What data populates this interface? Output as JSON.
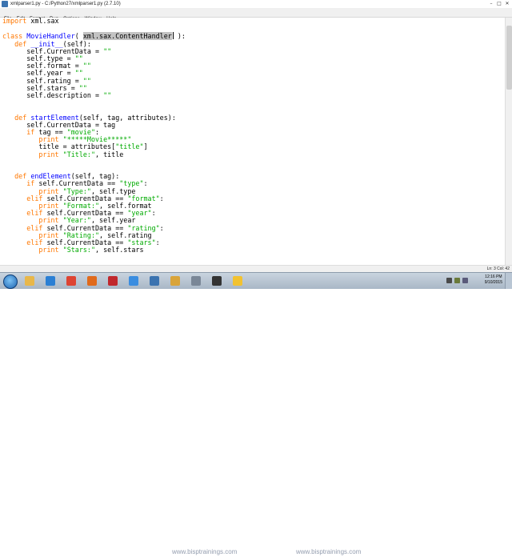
{
  "window": {
    "title": "xmlparser1.py - C:/Python27/xmlparser1.py (2.7.10)",
    "controls": [
      "–",
      "□",
      "✕"
    ]
  },
  "menu": [
    "File",
    "Edit",
    "Format",
    "Run",
    "Options",
    "Window",
    "Help"
  ],
  "code_lines": [
    [
      {
        "t": "import",
        "c": "kw"
      },
      {
        "t": " xml.sax"
      }
    ],
    [
      {
        "t": ""
      }
    ],
    [
      {
        "t": "class",
        "c": "kw"
      },
      {
        "t": " "
      },
      {
        "t": "MovieHandler",
        "c": "def"
      },
      {
        "t": "( "
      },
      {
        "t": "xml.sax.ContentHandler",
        "c": "sel"
      },
      {
        "t": "",
        "caret": true
      },
      {
        "t": " ):"
      }
    ],
    [
      {
        "t": "   "
      },
      {
        "t": "def",
        "c": "kw"
      },
      {
        "t": " "
      },
      {
        "t": "__init__",
        "c": "def"
      },
      {
        "t": "(self):"
      }
    ],
    [
      {
        "t": "      self.CurrentData = "
      },
      {
        "t": "\"\"",
        "c": "str"
      }
    ],
    [
      {
        "t": "      self.type = "
      },
      {
        "t": "\"\"",
        "c": "str"
      }
    ],
    [
      {
        "t": "      self.format = "
      },
      {
        "t": "\"\"",
        "c": "str"
      }
    ],
    [
      {
        "t": "      self.year = "
      },
      {
        "t": "\"\"",
        "c": "str"
      }
    ],
    [
      {
        "t": "      self.rating = "
      },
      {
        "t": "\"\"",
        "c": "str"
      }
    ],
    [
      {
        "t": "      self.stars = "
      },
      {
        "t": "\"\"",
        "c": "str"
      }
    ],
    [
      {
        "t": "      self.description = "
      },
      {
        "t": "\"\"",
        "c": "str"
      }
    ],
    [
      {
        "t": ""
      }
    ],
    [
      {
        "t": ""
      }
    ],
    [
      {
        "t": "   "
      },
      {
        "t": "def",
        "c": "kw"
      },
      {
        "t": " "
      },
      {
        "t": "startElement",
        "c": "def"
      },
      {
        "t": "(self, tag, attributes):"
      }
    ],
    [
      {
        "t": "      self.CurrentData = tag"
      }
    ],
    [
      {
        "t": "      "
      },
      {
        "t": "if",
        "c": "kw"
      },
      {
        "t": " tag == "
      },
      {
        "t": "\"movie\"",
        "c": "str"
      },
      {
        "t": ":"
      }
    ],
    [
      {
        "t": "         "
      },
      {
        "t": "print",
        "c": "kw"
      },
      {
        "t": " "
      },
      {
        "t": "\"*****Movie*****\"",
        "c": "str"
      }
    ],
    [
      {
        "t": "         title = attributes["
      },
      {
        "t": "\"title\"",
        "c": "str"
      },
      {
        "t": "]"
      }
    ],
    [
      {
        "t": "         "
      },
      {
        "t": "print",
        "c": "kw"
      },
      {
        "t": " "
      },
      {
        "t": "\"Title:\"",
        "c": "str"
      },
      {
        "t": ", title"
      }
    ],
    [
      {
        "t": ""
      }
    ],
    [
      {
        "t": ""
      }
    ],
    [
      {
        "t": "   "
      },
      {
        "t": "def",
        "c": "kw"
      },
      {
        "t": " "
      },
      {
        "t": "endElement",
        "c": "def"
      },
      {
        "t": "(self, tag):"
      }
    ],
    [
      {
        "t": "      "
      },
      {
        "t": "if",
        "c": "kw"
      },
      {
        "t": " self.CurrentData == "
      },
      {
        "t": "\"type\"",
        "c": "str"
      },
      {
        "t": ":"
      }
    ],
    [
      {
        "t": "         "
      },
      {
        "t": "print",
        "c": "kw"
      },
      {
        "t": " "
      },
      {
        "t": "\"Type:\"",
        "c": "str"
      },
      {
        "t": ", self.type"
      }
    ],
    [
      {
        "t": "      "
      },
      {
        "t": "elif",
        "c": "kw"
      },
      {
        "t": " self.CurrentData == "
      },
      {
        "t": "\"format\"",
        "c": "str"
      },
      {
        "t": ":"
      }
    ],
    [
      {
        "t": "         "
      },
      {
        "t": "print",
        "c": "kw"
      },
      {
        "t": " "
      },
      {
        "t": "\"Format:\"",
        "c": "str"
      },
      {
        "t": ", self.format"
      }
    ],
    [
      {
        "t": "      "
      },
      {
        "t": "elif",
        "c": "kw"
      },
      {
        "t": " self.CurrentData == "
      },
      {
        "t": "\"year\"",
        "c": "str"
      },
      {
        "t": ":"
      }
    ],
    [
      {
        "t": "         "
      },
      {
        "t": "print",
        "c": "kw"
      },
      {
        "t": " "
      },
      {
        "t": "\"Year:\"",
        "c": "str"
      },
      {
        "t": ", self.year"
      }
    ],
    [
      {
        "t": "      "
      },
      {
        "t": "elif",
        "c": "kw"
      },
      {
        "t": " self.CurrentData == "
      },
      {
        "t": "\"rating\"",
        "c": "str"
      },
      {
        "t": ":"
      }
    ],
    [
      {
        "t": "         "
      },
      {
        "t": "print",
        "c": "kw"
      },
      {
        "t": " "
      },
      {
        "t": "\"Rating:\"",
        "c": "str"
      },
      {
        "t": ", self.rating"
      }
    ],
    [
      {
        "t": "      "
      },
      {
        "t": "elif",
        "c": "kw"
      },
      {
        "t": " self.CurrentData == "
      },
      {
        "t": "\"stars\"",
        "c": "str"
      },
      {
        "t": ":"
      }
    ],
    [
      {
        "t": "         "
      },
      {
        "t": "print",
        "c": "kw"
      },
      {
        "t": " "
      },
      {
        "t": "\"Stars:\"",
        "c": "str"
      },
      {
        "t": ", self.stars"
      }
    ]
  ],
  "colors": {
    "keyword": "#ff7700",
    "definition": "#0000ff",
    "string": "#00aa00",
    "selection": "#c3c3c3"
  },
  "status": {
    "position": "Ln: 3 Col: 42"
  },
  "taskbar": {
    "apps": [
      {
        "name": "windows-explorer-icon",
        "color": "#e8b74a"
      },
      {
        "name": "internet-explorer-icon",
        "color": "#2a7fd4"
      },
      {
        "name": "chrome-icon",
        "color": "#dd4433"
      },
      {
        "name": "firefox-icon",
        "color": "#e06a1c"
      },
      {
        "name": "acrobat-icon",
        "color": "#c0282d"
      },
      {
        "name": "media-player-icon",
        "color": "#3a8de0"
      },
      {
        "name": "python-icon",
        "color": "#3b73b0"
      },
      {
        "name": "paint-icon",
        "color": "#d9a43a"
      },
      {
        "name": "settings-icon",
        "color": "#7a8797"
      },
      {
        "name": "terminal-icon",
        "color": "#333333"
      },
      {
        "name": "python-idle-icon",
        "color": "#f2c230"
      }
    ],
    "watermark_left": "www.bisptrainings.com",
    "watermark_right": "www.bisptrainings.com",
    "clock_time": "12:16 PM",
    "clock_date": "9/10/2015"
  }
}
